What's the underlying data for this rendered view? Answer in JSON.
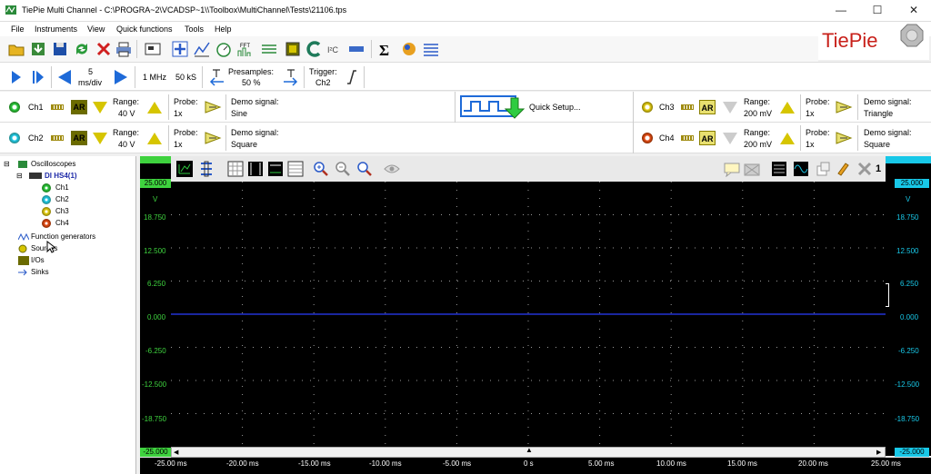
{
  "window": {
    "title": "TiePie Multi Channel - C:\\PROGRA~2\\VCADSP~1\\\\Toolbox\\MultiChannel\\Tests\\21106.tps",
    "minimize": "—",
    "maximize": "☐",
    "close": "✕"
  },
  "menu": [
    "File",
    "Instruments",
    "View",
    "Quick functions",
    "Tools",
    "Help"
  ],
  "logo": {
    "text": "TiePie",
    "badge": "TiePie engineering"
  },
  "acquisition": {
    "timebase_value": "5",
    "timebase_unit": "ms/div",
    "sample_rate": "1 MHz",
    "record_length": "50 kS",
    "presamples_label": "Presamples:",
    "presamples_value": "50 %",
    "trigger_label": "Trigger:",
    "trigger_value": "Ch2"
  },
  "channels": [
    {
      "name": "Ch1",
      "range_label": "Range:",
      "range": "40 V",
      "probe_label": "Probe:",
      "probe": "1x",
      "signal_label": "Demo signal:",
      "signal": "Sine",
      "color": "#2ecc40"
    },
    {
      "name": "Ch2",
      "range_label": "Range:",
      "range": "40 V",
      "probe_label": "Probe:",
      "probe": "1x",
      "signal_label": "Demo signal:",
      "signal": "Square",
      "color": "#18c8e8"
    },
    {
      "name": "Ch3",
      "range_label": "Range:",
      "range": "200 mV",
      "probe_label": "Probe:",
      "probe": "1x",
      "signal_label": "Demo signal:",
      "signal": "Triangle",
      "color": "#e8d21a"
    },
    {
      "name": "Ch4",
      "range_label": "Range:",
      "range": "200 mV",
      "probe_label": "Probe:",
      "probe": "1x",
      "signal_label": "Demo signal:",
      "signal": "Square",
      "color": "#e8501a"
    }
  ],
  "ar_label": "AR",
  "quick_setup": "Quick Setup...",
  "tree": {
    "oscilloscopes": "Oscilloscopes",
    "device": "DI HS4(1)",
    "channels": [
      "Ch1",
      "Ch2",
      "Ch3",
      "Ch4"
    ],
    "function_generators": "Function generators",
    "sources": "Sources",
    "ios": "I/Os",
    "sinks": "Sinks"
  },
  "scope": {
    "left_unit": "V",
    "right_unit": "V",
    "y_top": "25.000",
    "y_bottom": "-25.000",
    "y_ticks": [
      "18.750",
      "12.500",
      "6.250",
      "0.000",
      "-6.250",
      "-12.500",
      "-18.750"
    ],
    "x_ticks": [
      "-25.00 ms",
      "-20.00 ms",
      "-15.00 ms",
      "-10.00 ms",
      "-5.00 ms",
      "0 s",
      "5.00 ms",
      "10.00 ms",
      "15.00 ms",
      "20.00 ms",
      "25.00 ms"
    ],
    "graph_count": "1",
    "trace_color": "#2a3cff"
  }
}
